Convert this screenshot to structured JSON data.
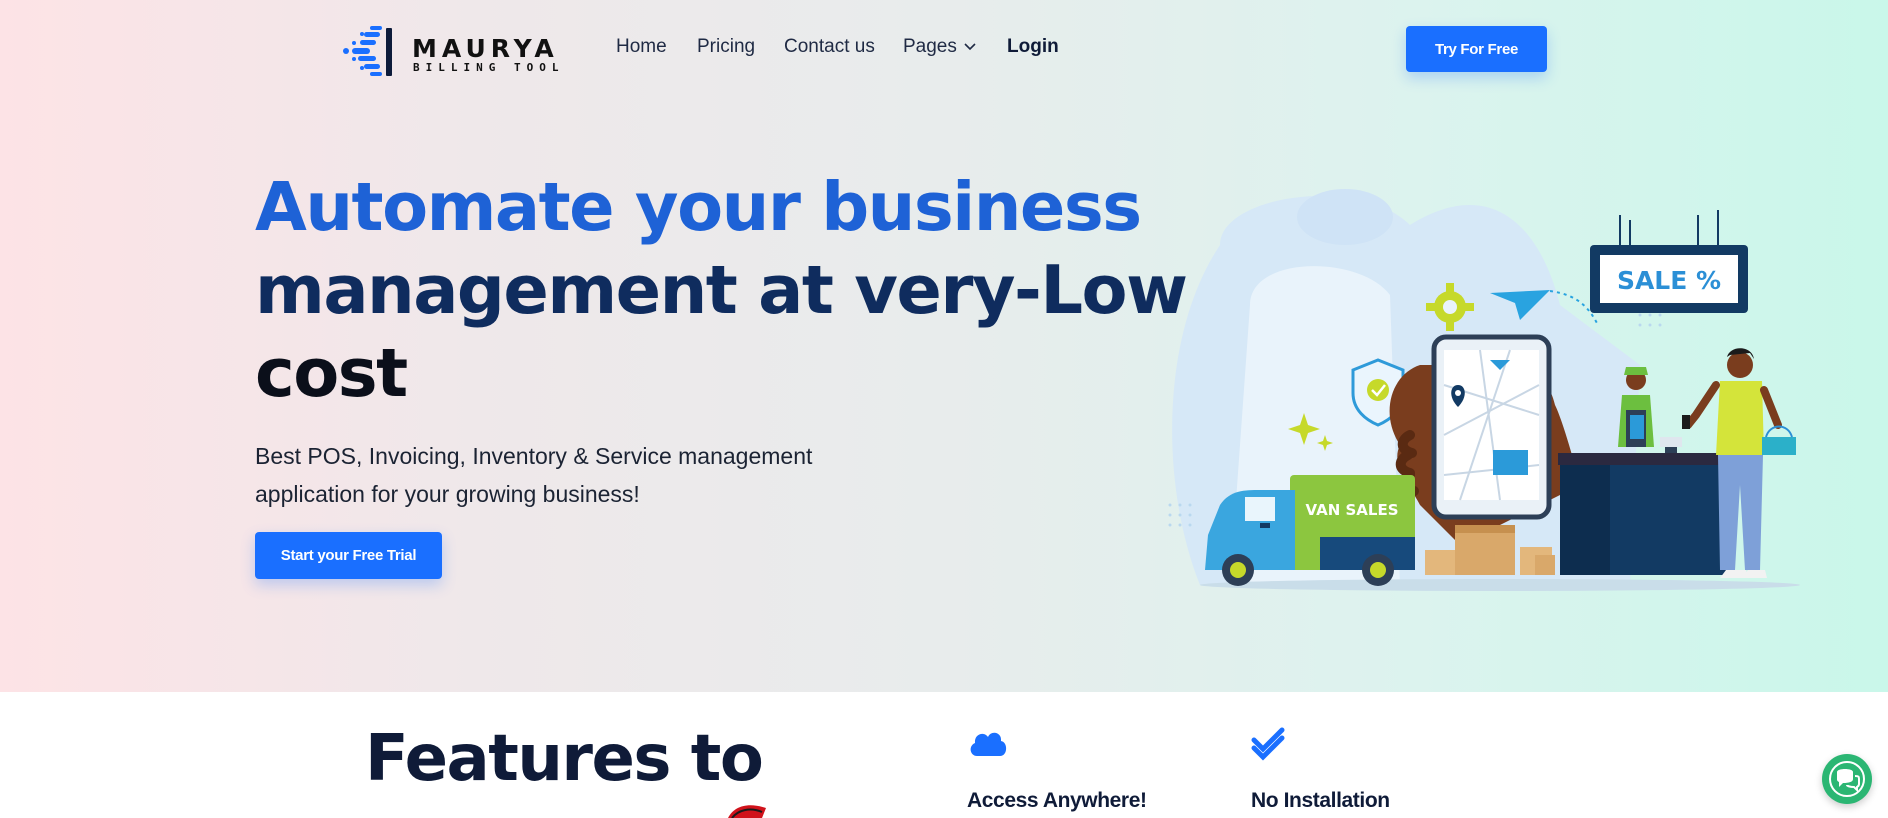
{
  "brand": {
    "name": "MAURYA",
    "tagline": "BILLING TOOL",
    "accent": "#1a6fff"
  },
  "nav": {
    "items": [
      {
        "label": "Home"
      },
      {
        "label": "Pricing"
      },
      {
        "label": "Contact us"
      },
      {
        "label": "Pages"
      }
    ],
    "login": "Login",
    "try_button": "Try For Free"
  },
  "hero": {
    "headline_line1": "Automate your business",
    "headline_line2": "management at very-Low",
    "headline_line3": "cost",
    "subtitle": "Best POS, Invoicing, Inventory & Service management application for your growing business!",
    "cta": "Start your Free Trial",
    "illustration": {
      "sale_sign": "SALE %",
      "van_label": "VAN SALES"
    }
  },
  "features": {
    "title": "Features to",
    "items": [
      {
        "icon": "cloud-icon",
        "label": "Access Anywhere!"
      },
      {
        "icon": "double-check-icon",
        "label": "No Installation"
      }
    ]
  },
  "chat": {
    "icon": "chat-bubbles-icon"
  }
}
